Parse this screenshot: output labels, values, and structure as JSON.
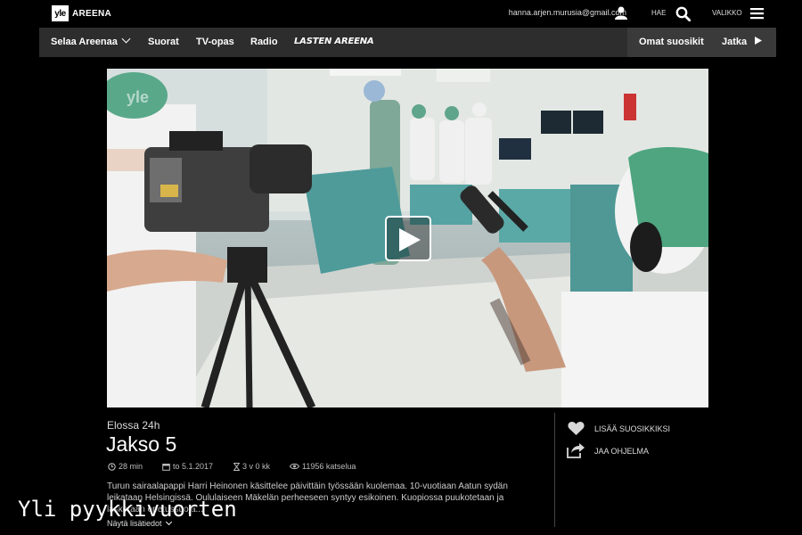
{
  "header": {
    "logo_mark": "yle",
    "logo_text": "AREENA",
    "user_email": "hanna.arjen.murusia@gmail.com",
    "search_label": "HAE",
    "menu_label": "VALIKKO",
    "icons": [
      "user-icon",
      "search-icon",
      "hamburger-menu-icon"
    ]
  },
  "nav": {
    "browse": "Selaa Areenaa",
    "live": "Suorat",
    "tv_guide": "TV-opas",
    "radio": "Radio",
    "kids": "LASTEN AREENA",
    "favorites": "Omat suosikit",
    "continue": "Jatka"
  },
  "program": {
    "series": "Elossa 24h",
    "title": "Jakso 5",
    "duration": "28 min",
    "date": "to 5.1.2017",
    "availability": "3 v 0 kk",
    "views": "11956 katselua",
    "description": "Turun sairaalapappi Harri Heinonen käsittelee päivittäin työssään kuolemaa. 10-vuotiaan Aatun sydän leikataan Helsingissä. Oululaiseen Mäkelän perheeseen syntyy esikoinen. Kuopiossa puukotetaan ja lasketaan opetussuoja...",
    "show_more": "Näytä lisätiedot"
  },
  "actions": {
    "add_favorite": "LISÄÄ SUOSIKKIKSI",
    "share": "JAA OHJELMA"
  },
  "overlay": {
    "watermark": "Yli pyykkivuorten"
  },
  "colors": {
    "background": "#000000",
    "navbar": "#2d2d2d",
    "text": "#ffffff"
  }
}
